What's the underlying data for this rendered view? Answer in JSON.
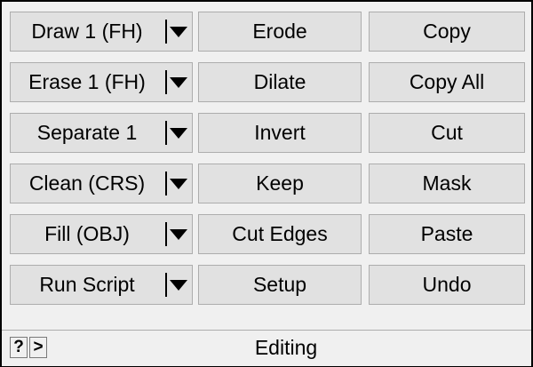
{
  "col1": [
    {
      "label": "Draw 1 (FH)",
      "icon": "chevron-down-icon"
    },
    {
      "label": "Erase 1 (FH)",
      "icon": "chevron-down-icon"
    },
    {
      "label": "Separate 1",
      "icon": "chevron-down-icon"
    },
    {
      "label": "Clean (CRS)",
      "icon": "chevron-down-icon"
    },
    {
      "label": "Fill (OBJ)",
      "icon": "chevron-down-icon"
    },
    {
      "label": "Run Script",
      "icon": "chevron-down-icon"
    }
  ],
  "col2": [
    "Erode",
    "Dilate",
    "Invert",
    "Keep",
    "Cut Edges",
    "Setup"
  ],
  "col3": [
    "Copy",
    "Copy All",
    "Cut",
    "Mask",
    "Paste",
    "Undo"
  ],
  "statusbar": {
    "help_label": "?",
    "more_label": ">",
    "title": "Editing"
  }
}
